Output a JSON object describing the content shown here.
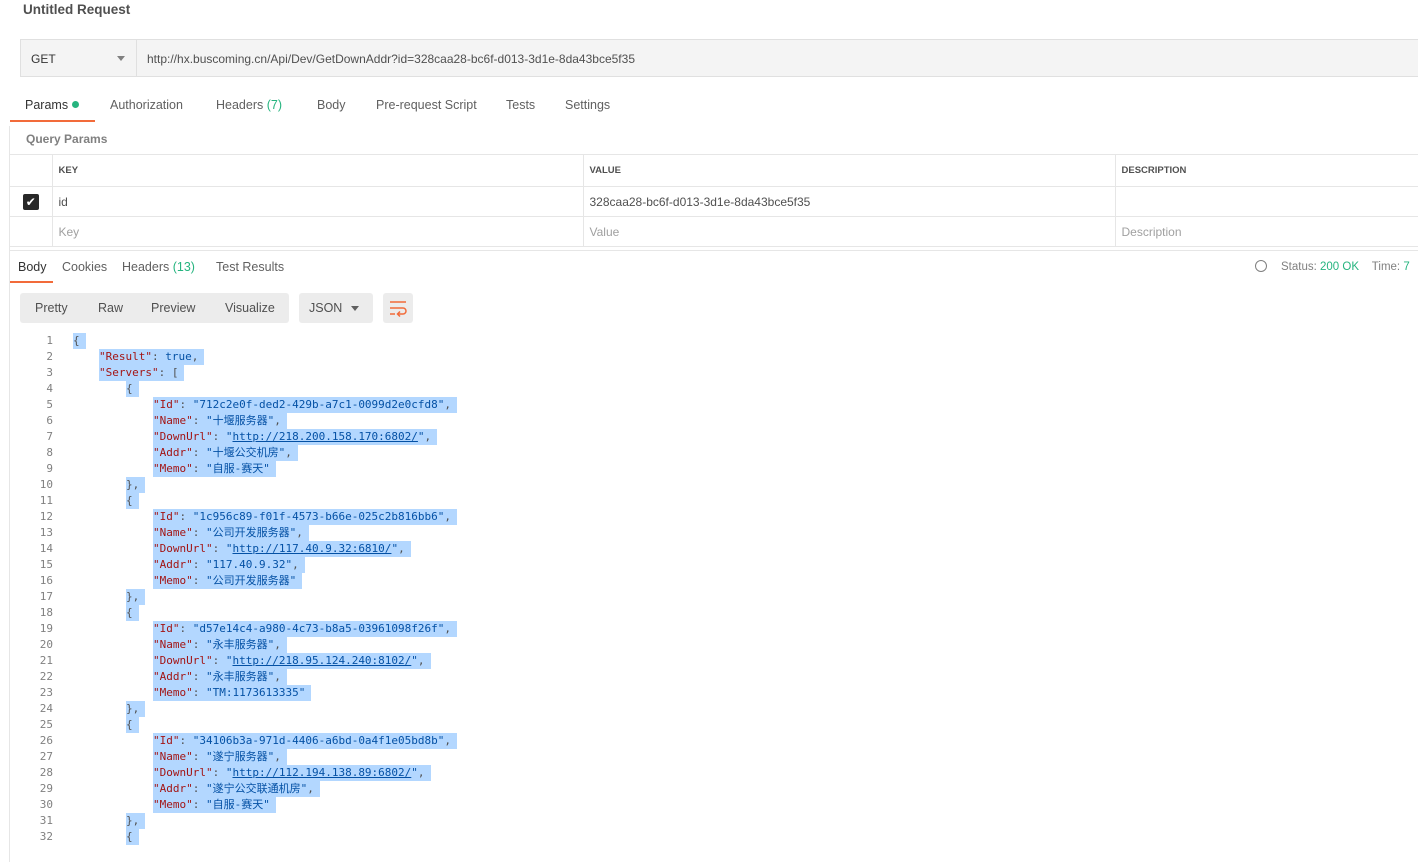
{
  "request": {
    "title": "Untitled Request",
    "method": "GET",
    "url": "http://hx.buscoming.cn/Api/Dev/GetDownAddr?id=328caa28-bc6f-d013-3d1e-8da43bce5f35"
  },
  "request_tabs": {
    "params": "Params",
    "authorization": "Authorization",
    "headers": "Headers",
    "headers_count": "(7)",
    "body": "Body",
    "prerequest": "Pre-request Script",
    "tests": "Tests",
    "settings": "Settings"
  },
  "query_params": {
    "title": "Query Params",
    "columns": {
      "key": "KEY",
      "value": "VALUE",
      "description": "DESCRIPTION"
    },
    "rows": [
      {
        "key": "id",
        "value": "328caa28-bc6f-d013-3d1e-8da43bce5f35",
        "description": ""
      }
    ],
    "placeholder": {
      "key": "Key",
      "value": "Value",
      "description": "Description"
    }
  },
  "response_tabs": {
    "body": "Body",
    "cookies": "Cookies",
    "headers": "Headers",
    "headers_count": "(13)",
    "test_results": "Test Results"
  },
  "status": {
    "label": "Status:",
    "value": "200 OK",
    "time_label": "Time:",
    "time_value": "7"
  },
  "view_modes": {
    "pretty": "Pretty",
    "raw": "Raw",
    "preview": "Preview",
    "visualize": "Visualize",
    "format": "JSON"
  },
  "code_lines": [
    {
      "n": "1",
      "indent": 0,
      "parts": [
        [
          "p",
          "{"
        ]
      ]
    },
    {
      "n": "2",
      "indent": 1,
      "parts": [
        [
          "k",
          "\"Result\""
        ],
        [
          "p",
          ": "
        ],
        [
          "b",
          "true"
        ],
        [
          "p",
          ","
        ]
      ]
    },
    {
      "n": "3",
      "indent": 1,
      "parts": [
        [
          "k",
          "\"Servers\""
        ],
        [
          "p",
          ": ["
        ]
      ]
    },
    {
      "n": "4",
      "indent": 2,
      "parts": [
        [
          "p",
          "{"
        ]
      ]
    },
    {
      "n": "5",
      "indent": 3,
      "parts": [
        [
          "k",
          "\"Id\""
        ],
        [
          "p",
          ": "
        ],
        [
          "s",
          "\"712c2e0f-ded2-429b-a7c1-0099d2e0cfd8\""
        ],
        [
          "p",
          ","
        ]
      ]
    },
    {
      "n": "6",
      "indent": 3,
      "parts": [
        [
          "k",
          "\"Name\""
        ],
        [
          "p",
          ": "
        ],
        [
          "s",
          "\"十堰服务器\""
        ],
        [
          "p",
          ","
        ]
      ]
    },
    {
      "n": "7",
      "indent": 3,
      "parts": [
        [
          "k",
          "\"DownUrl\""
        ],
        [
          "p",
          ": "
        ],
        [
          "s",
          "\""
        ],
        [
          "u",
          "http://218.200.158.170:6802/"
        ],
        [
          "s",
          "\""
        ],
        [
          "p",
          ","
        ]
      ]
    },
    {
      "n": "8",
      "indent": 3,
      "parts": [
        [
          "k",
          "\"Addr\""
        ],
        [
          "p",
          ": "
        ],
        [
          "s",
          "\"十堰公交机房\""
        ],
        [
          "p",
          ","
        ]
      ]
    },
    {
      "n": "9",
      "indent": 3,
      "parts": [
        [
          "k",
          "\"Memo\""
        ],
        [
          "p",
          ": "
        ],
        [
          "s",
          "\"自服-赛天\""
        ]
      ]
    },
    {
      "n": "10",
      "indent": 2,
      "parts": [
        [
          "p",
          "},"
        ]
      ]
    },
    {
      "n": "11",
      "indent": 2,
      "parts": [
        [
          "p",
          "{"
        ]
      ]
    },
    {
      "n": "12",
      "indent": 3,
      "parts": [
        [
          "k",
          "\"Id\""
        ],
        [
          "p",
          ": "
        ],
        [
          "s",
          "\"1c956c89-f01f-4573-b66e-025c2b816bb6\""
        ],
        [
          "p",
          ","
        ]
      ]
    },
    {
      "n": "13",
      "indent": 3,
      "parts": [
        [
          "k",
          "\"Name\""
        ],
        [
          "p",
          ": "
        ],
        [
          "s",
          "\"公司开发服务器\""
        ],
        [
          "p",
          ","
        ]
      ]
    },
    {
      "n": "14",
      "indent": 3,
      "parts": [
        [
          "k",
          "\"DownUrl\""
        ],
        [
          "p",
          ": "
        ],
        [
          "s",
          "\""
        ],
        [
          "u",
          "http://117.40.9.32:6810/"
        ],
        [
          "s",
          "\""
        ],
        [
          "p",
          ","
        ]
      ]
    },
    {
      "n": "15",
      "indent": 3,
      "parts": [
        [
          "k",
          "\"Addr\""
        ],
        [
          "p",
          ": "
        ],
        [
          "s",
          "\"117.40.9.32\""
        ],
        [
          "p",
          ","
        ]
      ]
    },
    {
      "n": "16",
      "indent": 3,
      "parts": [
        [
          "k",
          "\"Memo\""
        ],
        [
          "p",
          ": "
        ],
        [
          "s",
          "\"公司开发服务器\""
        ]
      ]
    },
    {
      "n": "17",
      "indent": 2,
      "parts": [
        [
          "p",
          "},"
        ]
      ]
    },
    {
      "n": "18",
      "indent": 2,
      "parts": [
        [
          "p",
          "{"
        ]
      ]
    },
    {
      "n": "19",
      "indent": 3,
      "parts": [
        [
          "k",
          "\"Id\""
        ],
        [
          "p",
          ": "
        ],
        [
          "s",
          "\"d57e14c4-a980-4c73-b8a5-03961098f26f\""
        ],
        [
          "p",
          ","
        ]
      ]
    },
    {
      "n": "20",
      "indent": 3,
      "parts": [
        [
          "k",
          "\"Name\""
        ],
        [
          "p",
          ": "
        ],
        [
          "s",
          "\"永丰服务器\""
        ],
        [
          "p",
          ","
        ]
      ]
    },
    {
      "n": "21",
      "indent": 3,
      "parts": [
        [
          "k",
          "\"DownUrl\""
        ],
        [
          "p",
          ": "
        ],
        [
          "s",
          "\""
        ],
        [
          "u",
          "http://218.95.124.240:8102/"
        ],
        [
          "s",
          "\""
        ],
        [
          "p",
          ","
        ]
      ]
    },
    {
      "n": "22",
      "indent": 3,
      "parts": [
        [
          "k",
          "\"Addr\""
        ],
        [
          "p",
          ": "
        ],
        [
          "s",
          "\"永丰服务器\""
        ],
        [
          "p",
          ","
        ]
      ]
    },
    {
      "n": "23",
      "indent": 3,
      "parts": [
        [
          "k",
          "\"Memo\""
        ],
        [
          "p",
          ": "
        ],
        [
          "s",
          "\"TM:1173613335\""
        ]
      ]
    },
    {
      "n": "24",
      "indent": 2,
      "parts": [
        [
          "p",
          "},"
        ]
      ]
    },
    {
      "n": "25",
      "indent": 2,
      "parts": [
        [
          "p",
          "{"
        ]
      ]
    },
    {
      "n": "26",
      "indent": 3,
      "parts": [
        [
          "k",
          "\"Id\""
        ],
        [
          "p",
          ": "
        ],
        [
          "s",
          "\"34106b3a-971d-4406-a6bd-0a4f1e05bd8b\""
        ],
        [
          "p",
          ","
        ]
      ]
    },
    {
      "n": "27",
      "indent": 3,
      "parts": [
        [
          "k",
          "\"Name\""
        ],
        [
          "p",
          ": "
        ],
        [
          "s",
          "\"遂宁服务器\""
        ],
        [
          "p",
          ","
        ]
      ]
    },
    {
      "n": "28",
      "indent": 3,
      "parts": [
        [
          "k",
          "\"DownUrl\""
        ],
        [
          "p",
          ": "
        ],
        [
          "s",
          "\""
        ],
        [
          "u",
          "http://112.194.138.89:6802/"
        ],
        [
          "s",
          "\""
        ],
        [
          "p",
          ","
        ]
      ]
    },
    {
      "n": "29",
      "indent": 3,
      "parts": [
        [
          "k",
          "\"Addr\""
        ],
        [
          "p",
          ": "
        ],
        [
          "s",
          "\"遂宁公交联通机房\""
        ],
        [
          "p",
          ","
        ]
      ]
    },
    {
      "n": "30",
      "indent": 3,
      "parts": [
        [
          "k",
          "\"Memo\""
        ],
        [
          "p",
          ": "
        ],
        [
          "s",
          "\"自服-赛天\""
        ]
      ]
    },
    {
      "n": "31",
      "indent": 2,
      "parts": [
        [
          "p",
          "},"
        ]
      ]
    },
    {
      "n": "32",
      "indent": 2,
      "parts": [
        [
          "p",
          "{"
        ]
      ]
    }
  ],
  "colors": {
    "accent": "#f26b3a",
    "success": "#26b47f",
    "selection": "#b3d7ff"
  }
}
